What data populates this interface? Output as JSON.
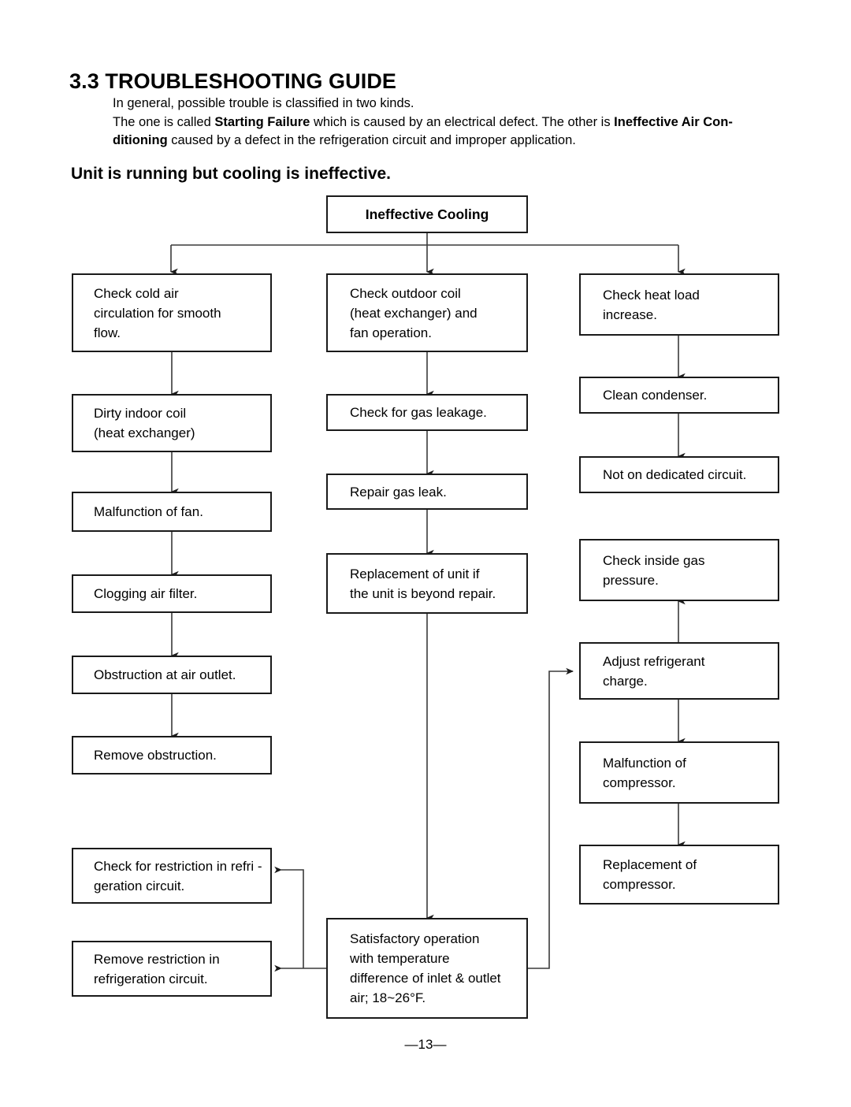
{
  "document": {
    "section_title": "3.3 TROUBLESHOOTING GUIDE",
    "intro_line1": "In general, possible trouble is classified in two kinds.",
    "intro_line2_part1": "The one is called ",
    "intro_line2_bold1": "Starting Failure",
    "intro_line2_part2": " which is caused by an electrical defect. The other is ",
    "intro_line2_bold2": "Ineffective Air Con-",
    "intro_line3_bold": "ditioning",
    "intro_line3_rest": " caused by a defect in the refrigeration circuit and improper application.",
    "subheading": "Unit is running but cooling is ineffective.",
    "page_number": "—13—"
  },
  "flowchart": {
    "title": "Ineffective Cooling Troubleshooting Flow",
    "root": {
      "label": "Ineffective Cooling"
    },
    "column_left": [
      {
        "id": "check-cold-air",
        "label": "Check cold air\ncirculation for smooth\nflow."
      },
      {
        "id": "dirty-indoor-coil",
        "label": "Dirty indoor coil\n(heat exchanger)"
      },
      {
        "id": "malfunction-of-fan",
        "label": "Malfunction of fan."
      },
      {
        "id": "clogging-air-filter",
        "label": "Clogging air filter."
      },
      {
        "id": "obstruction-at-air-outlet",
        "label": "Obstruction at air outlet."
      },
      {
        "id": "remove-obstruction",
        "label": "Remove obstruction."
      },
      {
        "id": "check-restriction",
        "label": "Check for restriction in refri -\n  geration circuit."
      },
      {
        "id": "remove-restriction",
        "label": "Remove restriction  in\nrefrigeration circuit."
      }
    ],
    "column_middle": [
      {
        "id": "check-outdoor-coil",
        "label": "Check outdoor coil\n(heat exchanger) and\nfan operation."
      },
      {
        "id": "check-gas-leakage",
        "label": "Check for gas leakage."
      },
      {
        "id": "repair-gas-leak",
        "label": "Repair gas leak."
      },
      {
        "id": "replacement-of-unit",
        "label": "Replacement of unit if\nthe unit is beyond repair."
      },
      {
        "id": "satisfactory-operation",
        "label": "Satisfactory operation\nwith temperature\ndifference of inlet & outlet\nair; 18~26°F."
      }
    ],
    "column_right": [
      {
        "id": "check-heat-load",
        "label": "Check heat load\nincrease."
      },
      {
        "id": "clean-condenser",
        "label": "Clean condenser."
      },
      {
        "id": "not-on-dedicated-circuit",
        "label": "Not on dedicated circuit."
      },
      {
        "id": "check-inside-gas-pressure",
        "label": "Check inside gas\npressure."
      },
      {
        "id": "adjust-refrigerant-charge",
        "label": "Adjust refrigerant\ncharge."
      },
      {
        "id": "malfunction-of-compressor",
        "label": "Malfunction of\ncompressor."
      },
      {
        "id": "replacement-of-compressor",
        "label": "Replacement of\ncompressor."
      }
    ],
    "colors": {
      "border": "#1a1a1a",
      "connector": "#3a3a3a",
      "background": "#ffffff"
    }
  }
}
